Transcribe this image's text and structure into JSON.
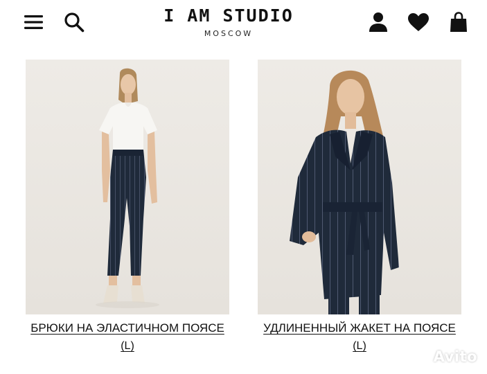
{
  "header": {
    "brand_title": "I AM STUDIO",
    "brand_subtitle": "MOSCOW",
    "icons": [
      "menu-icon",
      "search-icon",
      "user-icon",
      "heart-icon",
      "shopping-bag-icon"
    ]
  },
  "products": [
    {
      "name": "БРЮКИ НА ЭЛАСТИЧНОМ ПОЯСЕ",
      "size": "(L)"
    },
    {
      "name": "УДЛИНЕННЫЙ ЖАКЕТ НА ПОЯСЕ",
      "size": "(L)"
    }
  ],
  "watermark": {
    "text": "Avito"
  },
  "colors": {
    "text": "#111111",
    "photo_background": "#ebe8e3",
    "garment_navy": "#1f2a3a"
  }
}
